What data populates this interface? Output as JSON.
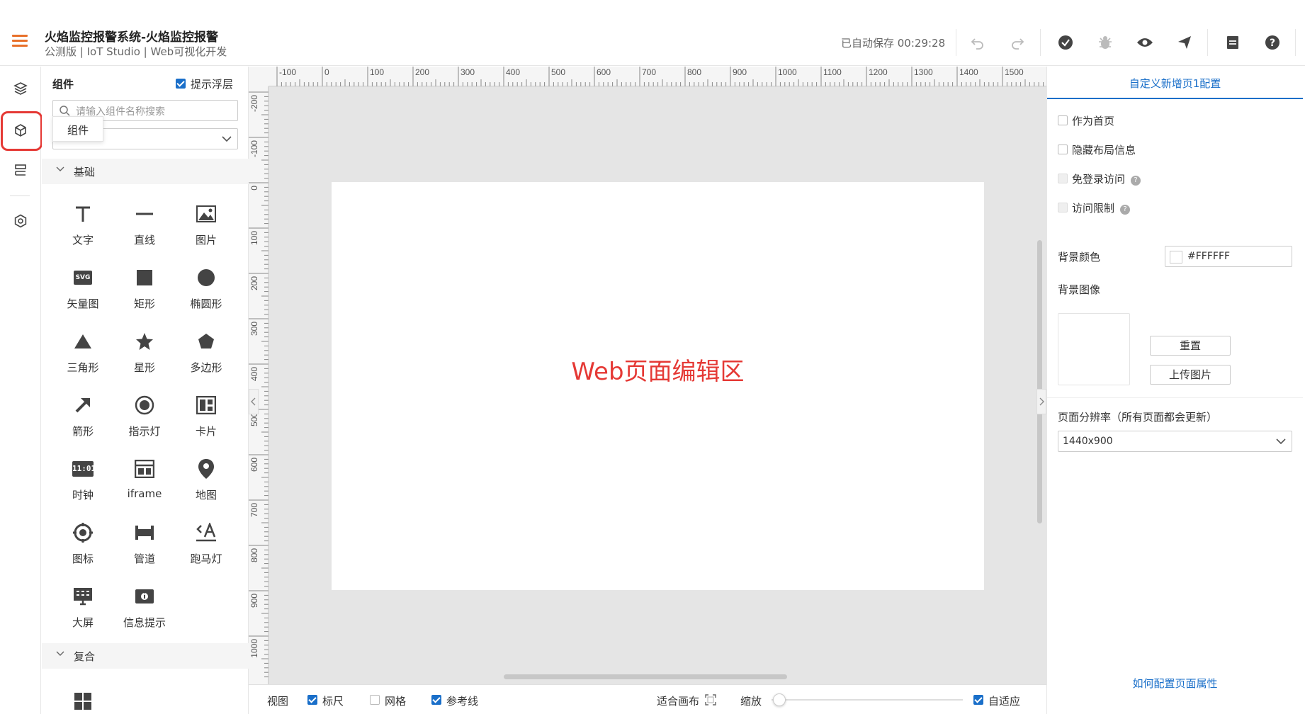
{
  "header": {
    "title": "火焰监控报警系统-火焰监控报警",
    "subtitle": "公测版 | IoT Studio | Web可视化开发",
    "autosave": "已自动保存 00:29:28",
    "icons": [
      "undo-icon",
      "redo-icon",
      "check-icon",
      "bug-icon",
      "eye-icon",
      "publish-icon",
      "document-icon",
      "help-icon"
    ]
  },
  "iconbar": {
    "items": [
      "layers-icon",
      "component-cube-icon",
      "page-list-icon",
      "settings-icon"
    ]
  },
  "component_panel": {
    "title": "组件",
    "show_float_label": "提示浮层",
    "search_placeholder": "请输入组件名称搜索",
    "tooltip": "组件",
    "groups": [
      {
        "label": "基础",
        "items": [
          {
            "icon": "text-icon",
            "label": "文字"
          },
          {
            "icon": "line-icon",
            "label": "直线"
          },
          {
            "icon": "image-icon",
            "label": "图片"
          },
          {
            "icon": "svg-icon",
            "label": "矢量图"
          },
          {
            "icon": "rectangle-icon",
            "label": "矩形"
          },
          {
            "icon": "ellipse-icon",
            "label": "椭圆形"
          },
          {
            "icon": "triangle-icon",
            "label": "三角形"
          },
          {
            "icon": "star-icon",
            "label": "星形"
          },
          {
            "icon": "polygon-icon",
            "label": "多边形"
          },
          {
            "icon": "arrow-icon",
            "label": "箭形"
          },
          {
            "icon": "indicator-light-icon",
            "label": "指示灯"
          },
          {
            "icon": "card-icon",
            "label": "卡片"
          },
          {
            "icon": "clock-icon",
            "label": "时钟"
          },
          {
            "icon": "iframe-icon",
            "label": "iframe"
          },
          {
            "icon": "map-pin-icon",
            "label": "地图"
          },
          {
            "icon": "badge-icon",
            "label": "图标"
          },
          {
            "icon": "pipe-icon",
            "label": "管道"
          },
          {
            "icon": "marquee-icon",
            "label": "跑马灯"
          },
          {
            "icon": "big-screen-icon",
            "label": "大屏"
          },
          {
            "icon": "info-tip-icon",
            "label": "信息提示"
          }
        ]
      },
      {
        "label": "复合",
        "items": [
          {
            "icon": "grid-icon",
            "label": ""
          }
        ]
      }
    ],
    "clock_text": "11:01",
    "svg_text": "SVG"
  },
  "canvas": {
    "label": "Web页面编辑区",
    "ruler_top": [
      "-100",
      "0",
      "100",
      "200",
      "300",
      "400",
      "500",
      "600",
      "700",
      "800",
      "900",
      "1000",
      "1100",
      "1200",
      "1300",
      "1400",
      "1500"
    ],
    "ruler_left": [
      "-200",
      "-100",
      "0",
      "100",
      "200",
      "300",
      "400",
      "500",
      "600",
      "700",
      "800",
      "900",
      "1000"
    ]
  },
  "bottombar": {
    "view": "视图",
    "ruler": "标尺",
    "grid": "网格",
    "guide": "参考线",
    "fit": "适合画布",
    "zoom": "缩放",
    "auto": "自适应",
    "ruler_checked": true,
    "grid_checked": false,
    "guide_checked": true,
    "auto_checked": true,
    "zoom_level": 0.0
  },
  "right_panel": {
    "tab": "自定义新增页1配置",
    "options": [
      {
        "label": "作为首页",
        "disabled": false,
        "help": false
      },
      {
        "label": "隐藏布局信息",
        "disabled": false,
        "help": false
      },
      {
        "label": "免登录访问",
        "disabled": true,
        "help": true
      },
      {
        "label": "访问限制",
        "disabled": true,
        "help": true
      }
    ],
    "bg_color_label": "背景颜色",
    "bg_color_value": "#FFFFFF",
    "bg_image_label": "背景图像",
    "reset_button": "重置",
    "upload_button": "上传图片",
    "resolution_label": "页面分辨率（所有页面都会更新）",
    "resolution_value": "1440x900",
    "help_link": "如何配置页面属性"
  },
  "colors": {
    "accent": "#1a6fc9",
    "brand_orange": "#e8702a",
    "highlight_red": "#e53935"
  }
}
